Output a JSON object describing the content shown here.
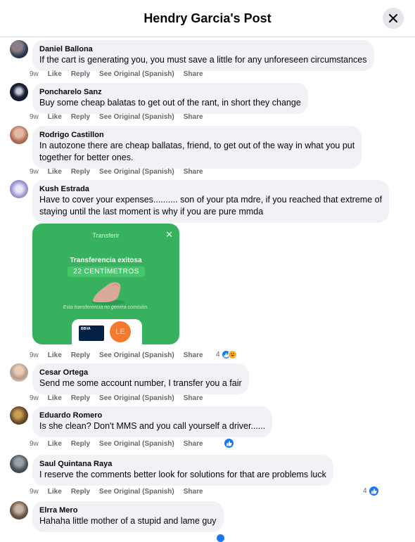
{
  "header": {
    "title": "Hendry Garcia's Post"
  },
  "actions": {
    "like": "Like",
    "reply": "Reply",
    "see_original": "See Original (Spanish)",
    "share": "Share"
  },
  "comments": [
    {
      "author": "Daniel Ballona",
      "text": [
        "If the cart is generating you, you must save a little for any unforeseen circumstances"
      ],
      "time": "9w"
    },
    {
      "author": "Poncharelo Sanz",
      "text": [
        "Buy some cheap balatas to get out of the rant, in short they change"
      ],
      "time": "9w"
    },
    {
      "author": "Rodrigo Castillon",
      "text": [
        "In autozone there are cheap ballatas, friend, to get out of the way in what you put",
        "together for better ones."
      ],
      "time": "9w"
    },
    {
      "author": "Kush Estrada",
      "text": [
        "Have to cover your expenses.......... son of your pta mdre, if you reached that extreme of",
        "staying until the last moment is why if you are pure mmda"
      ],
      "time": "9w",
      "reactions": "4",
      "attachment": {
        "header": "Transferir",
        "title": "Transferencia exitosa",
        "amount": "22 CENTÍMETROS",
        "note": "Esta transferencia no genera comisión.",
        "bank": "BBVA",
        "initials": "LE"
      }
    },
    {
      "author": "Cesar Ortega",
      "text": [
        "Send me some account number, I transfer you a fair"
      ],
      "time": "9w"
    },
    {
      "author": "Eduardo Romero",
      "text": [
        "Is she clean? Don't MMS and you call yourself a driver......"
      ],
      "time": "9w"
    },
    {
      "author": "Saul Quintana Raya",
      "text": [
        "I reserve the comments better look for solutions for that are problems luck"
      ],
      "time": "9w",
      "reactions": "4"
    },
    {
      "author": "Elrra Mero",
      "text": [
        "Hahaha little mother of a stupid and lame guy"
      ],
      "time": ""
    }
  ],
  "colors": {
    "like_blue": "#1877f2",
    "bubble_bg": "#f0f2f5",
    "meta_gray": "#65676b",
    "transfer_green": "#37b15d"
  }
}
